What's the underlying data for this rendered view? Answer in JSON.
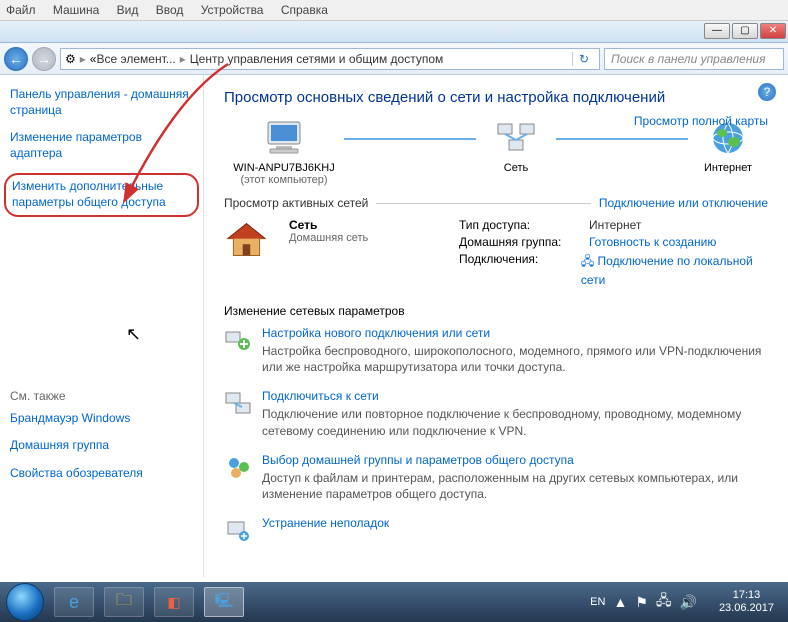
{
  "vm_menu": [
    "Файл",
    "Машина",
    "Вид",
    "Ввод",
    "Устройства",
    "Справка"
  ],
  "addr": {
    "back_prefix": "«",
    "crumb1": "Все элемент...",
    "crumb2": "Центр управления сетями и общим доступом"
  },
  "search": {
    "placeholder": "Поиск в панели управления"
  },
  "sidebar": {
    "home": "Панель управления - домашняя страница",
    "adapter": "Изменение параметров адаптера",
    "sharing": "Изменить дополнительные параметры общего доступа",
    "also": "См. также",
    "firewall": "Брандмауэр Windows",
    "homegroup": "Домашняя группа",
    "inet": "Свойства обозревателя"
  },
  "main": {
    "title": "Просмотр основных сведений о сети и настройка подключений",
    "map_link": "Просмотр полной карты",
    "node1": "WIN-ANPU7BJ6KHJ",
    "node1_sub": "(этот компьютер)",
    "node2": "Сеть",
    "node3": "Интернет",
    "active_title": "Просмотр активных сетей",
    "active_link": "Подключение или отключение",
    "net_name": "Сеть",
    "net_type": "Домашняя сеть",
    "details": {
      "access_l": "Тип доступа:",
      "access_v": "Интернет",
      "home_l": "Домашняя группа:",
      "home_v": "Готовность к созданию",
      "conn_l": "Подключения:",
      "conn_v": "Подключение по локальной сети"
    },
    "settings_title": "Изменение сетевых параметров",
    "s1_link": "Настройка нового подключения или сети",
    "s1_desc": "Настройка беспроводного, широкополосного, модемного, прямого или VPN-подключения или же настройка маршрутизатора или точки доступа.",
    "s2_link": "Подключиться к сети",
    "s2_desc": "Подключение или повторное подключение к беспроводному, проводному, модемному сетевому соединению или подключение к VPN.",
    "s3_link": "Выбор домашней группы и параметров общего доступа",
    "s3_desc": "Доступ к файлам и принтерам, расположенным на других сетевых компьютерах, или изменение параметров общего доступа.",
    "s4_link": "Устранение неполадок"
  },
  "tray": {
    "lang": "EN",
    "time": "17:13",
    "date": "23.06.2017"
  }
}
